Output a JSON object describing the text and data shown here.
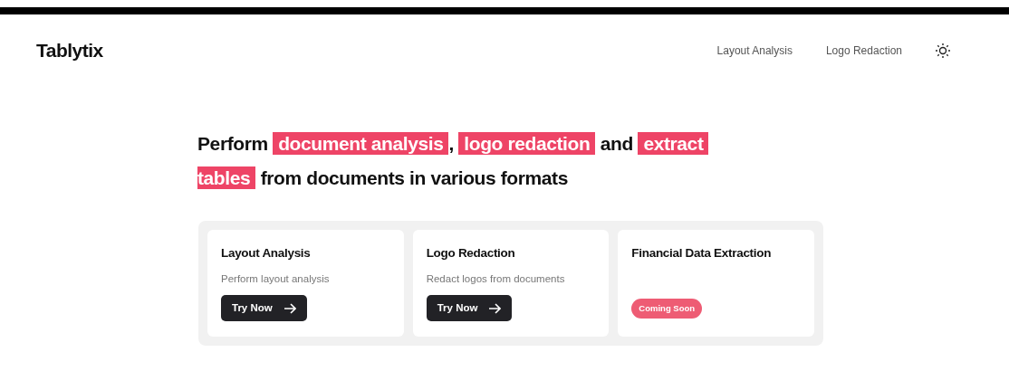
{
  "brand": "Tablytix",
  "nav": [
    {
      "label": "Layout Analysis"
    },
    {
      "label": "Logo Redaction"
    }
  ],
  "headline": [
    {
      "text": "Perform ",
      "highlight": false
    },
    {
      "text": "document analysis",
      "highlight": true
    },
    {
      "text": ", ",
      "highlight": false
    },
    {
      "text": "logo redaction",
      "highlight": true
    },
    {
      "text": " and ",
      "highlight": false
    },
    {
      "text": "extract tables",
      "highlight": true
    },
    {
      "text": " from documents in various formats",
      "highlight": false
    }
  ],
  "cards": [
    {
      "kind": "available",
      "title": "Layout Analysis",
      "description": "Perform layout analysis",
      "button": "Try Now"
    },
    {
      "kind": "available",
      "title": "Logo Redaction",
      "description": "Redact logos from documents",
      "button": "Try Now"
    },
    {
      "kind": "coming_soon",
      "title": "Financial Data Extraction",
      "badge": "Coming Soon"
    }
  ]
}
